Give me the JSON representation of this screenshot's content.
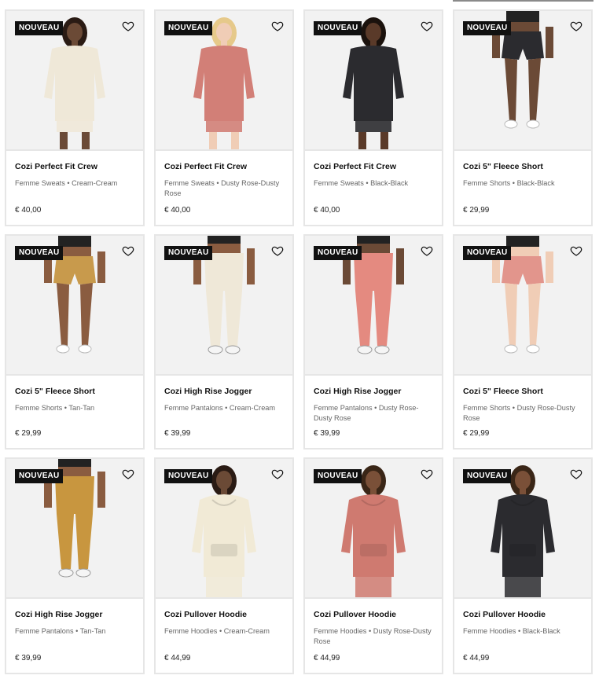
{
  "badge_label": "NOUVEAU",
  "colors": {
    "badge_bg": "#111111",
    "image_bg": "#f2f2f2",
    "border": "#e6e6e6"
  },
  "products": [
    {
      "title": "Cozi Perfect Fit Crew",
      "sub": "Femme Sweats • Cream-Cream",
      "price": "€ 40,00",
      "garment": "sweat",
      "color": "#efe8d8",
      "skin": "#6b4a36",
      "hair": "#2a1b14"
    },
    {
      "title": "Cozi Perfect Fit Crew",
      "sub": "Femme Sweats • Dusty Rose-Dusty Rose",
      "price": "€ 40,00",
      "garment": "sweat",
      "color": "#d27f77",
      "skin": "#f0cdb6",
      "hair": "#e6c98a"
    },
    {
      "title": "Cozi Perfect Fit Crew",
      "sub": "Femme Sweats • Black-Black",
      "price": "€ 40,00",
      "garment": "sweat",
      "color": "#2b2b2f",
      "skin": "#5a3a29",
      "hair": "#1b120d"
    },
    {
      "title": "Cozi 5\" Fleece Short",
      "sub": "Femme Shorts • Black-Black",
      "price": "€ 29,99",
      "garment": "short",
      "color": "#2b2b2f",
      "skin": "#6b4a36",
      "hair": "#1b120d"
    },
    {
      "title": "Cozi 5\" Fleece Short",
      "sub": "Femme Shorts • Tan-Tan",
      "price": "€ 29,99",
      "garment": "short",
      "color": "#c89a4c",
      "skin": "#8a5c40",
      "hair": "#1b120d"
    },
    {
      "title": "Cozi High Rise Jogger",
      "sub": "Femme Pantalons • Cream-Cream",
      "price": "€ 39,99",
      "garment": "jogger",
      "color": "#efe8d8",
      "skin": "#8a5c40",
      "hair": "#1b120d"
    },
    {
      "title": "Cozi High Rise Jogger",
      "sub": "Femme Pantalons • Dusty Rose-Dusty Rose",
      "price": "€ 39,99",
      "garment": "jogger",
      "color": "#e48a80",
      "skin": "#6b4a36",
      "hair": "#1b120d"
    },
    {
      "title": "Cozi 5\" Fleece Short",
      "sub": "Femme Shorts • Dusty Rose-Dusty Rose",
      "price": "€ 29,99",
      "garment": "short",
      "color": "#e2958c",
      "skin": "#f0cdb6",
      "hair": "#e6c98a"
    },
    {
      "title": "Cozi High Rise Jogger",
      "sub": "Femme Pantalons • Tan-Tan",
      "price": "€ 39,99",
      "garment": "jogger",
      "color": "#c8963f",
      "skin": "#8a5c40",
      "hair": "#1b120d"
    },
    {
      "title": "Cozi Pullover Hoodie",
      "sub": "Femme Hoodies • Cream-Cream",
      "price": "€ 44,99",
      "garment": "hoodie",
      "color": "#f1ead6",
      "skin": "#6b4a36",
      "hair": "#2a1b14"
    },
    {
      "title": "Cozi Pullover Hoodie",
      "sub": "Femme Hoodies • Dusty Rose-Dusty Rose",
      "price": "€ 44,99",
      "garment": "hoodie",
      "color": "#cf7a70",
      "skin": "#7a5038",
      "hair": "#3a2617"
    },
    {
      "title": "Cozi Pullover Hoodie",
      "sub": "Femme Hoodies • Black-Black",
      "price": "€ 44,99",
      "garment": "hoodie",
      "color": "#2b2b2f",
      "skin": "#7a5038",
      "hair": "#3a2617"
    }
  ]
}
